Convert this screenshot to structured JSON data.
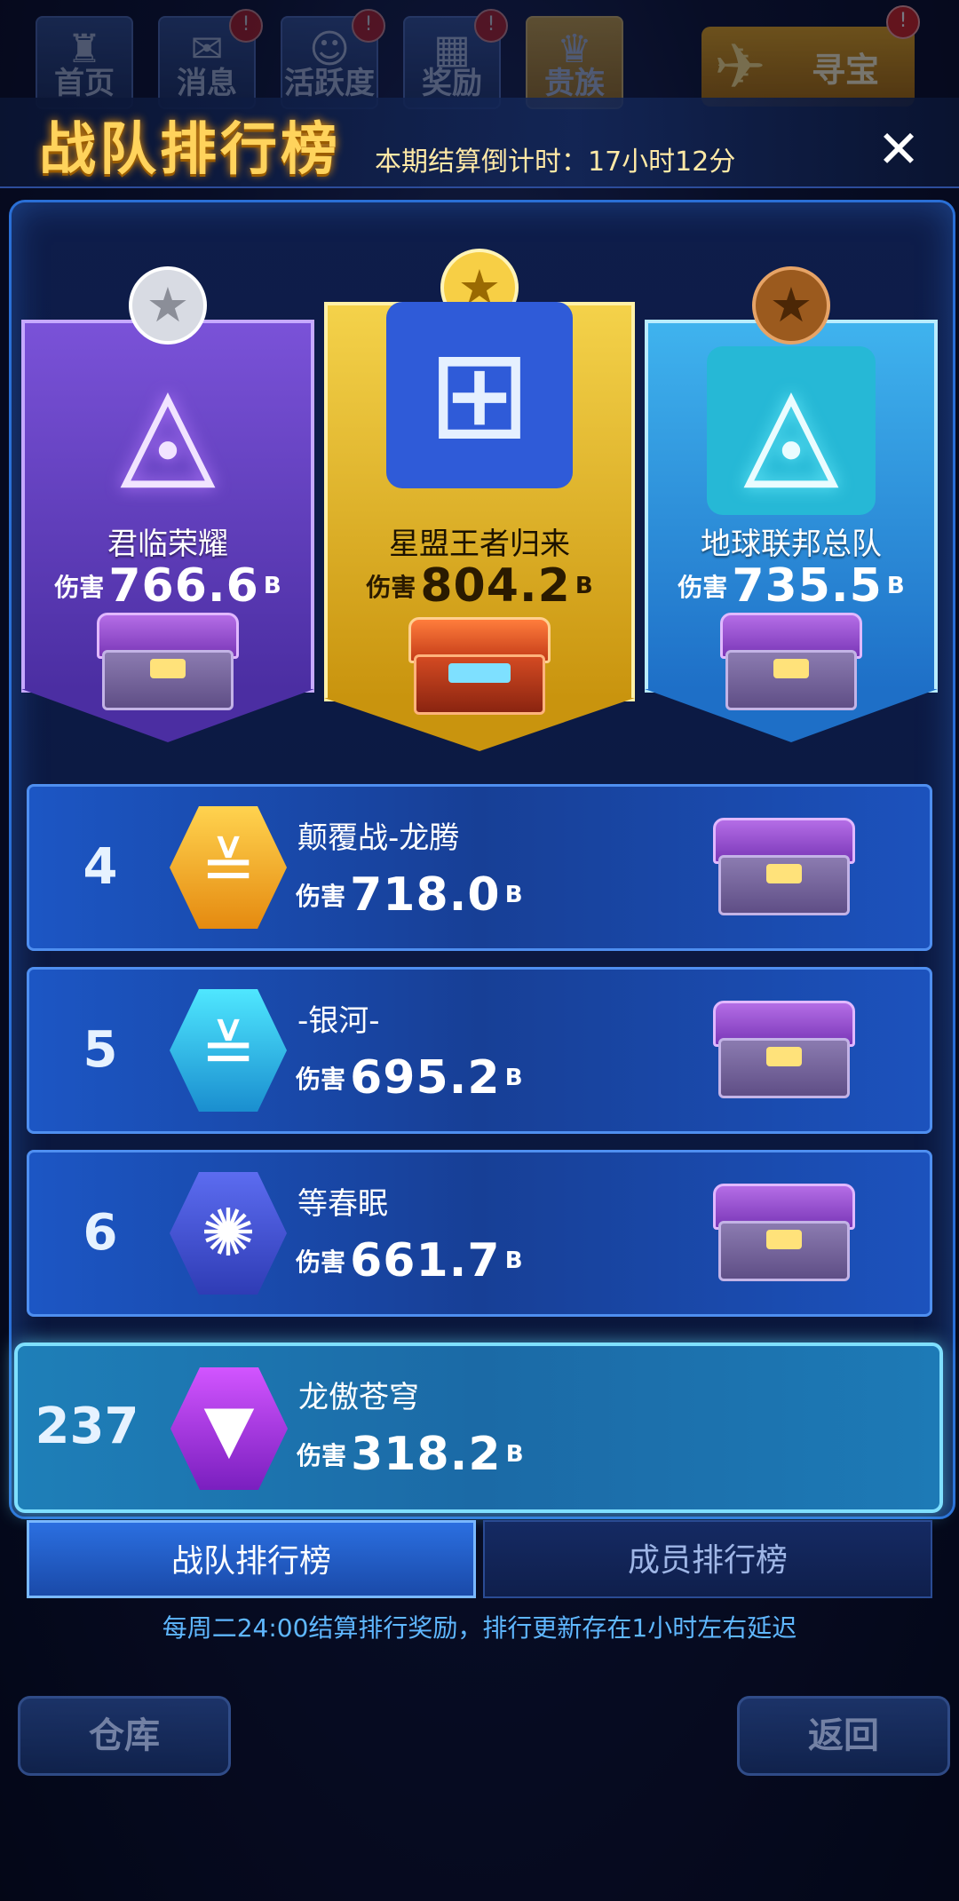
{
  "nav": {
    "tabs": [
      {
        "label": "首页",
        "badge": ""
      },
      {
        "label": "消息",
        "badge": "!"
      },
      {
        "label": "活跃度",
        "badge": "!"
      },
      {
        "label": "奖励",
        "badge": "!"
      },
      {
        "label": "贵族",
        "badge": ""
      }
    ],
    "treasure": {
      "label": "寻宝",
      "badge": "!"
    }
  },
  "header": {
    "title": "战队排行榜",
    "countdown": "本期结算倒计时：17小时12分",
    "close_icon": "✕"
  },
  "podium": [
    {
      "rank": 2,
      "name": "君临荣耀",
      "damage_label": "伤害",
      "damage": "766.6",
      "unit": "B",
      "medal": "silver",
      "chest": "purple"
    },
    {
      "rank": 1,
      "name": "星盟王者归来",
      "damage_label": "伤害",
      "damage": "804.2",
      "unit": "B",
      "medal": "gold",
      "chest": "red"
    },
    {
      "rank": 3,
      "name": "地球联邦总队",
      "damage_label": "伤害",
      "damage": "735.5",
      "unit": "B",
      "medal": "bronze",
      "chest": "purple"
    }
  ],
  "rows": [
    {
      "rank": "4",
      "name": "颠覆战-龙腾",
      "damage_label": "伤害",
      "damage": "718.0",
      "unit": "B"
    },
    {
      "rank": "5",
      "name": "-银河-",
      "damage_label": "伤害",
      "damage": "695.2",
      "unit": "B"
    },
    {
      "rank": "6",
      "name": "等春眠",
      "damage_label": "伤害",
      "damage": "661.7",
      "unit": "B"
    }
  ],
  "my_team": {
    "rank": "237",
    "name": "龙傲苍穹",
    "damage_label": "伤害",
    "damage": "318.2",
    "unit": "B"
  },
  "tabs": {
    "team": "战队排行榜",
    "member": "成员排行榜"
  },
  "footnote": "每周二24:00结算排行奖励，排行更新存在1小时左右延迟",
  "bottom": {
    "warehouse": "仓库",
    "back": "返回"
  },
  "colors": {
    "title_gold": "#ffd35c",
    "row_blue": "#1c56c4",
    "my_row": "#1e7fb8",
    "footnote": "#5fb7ff"
  }
}
